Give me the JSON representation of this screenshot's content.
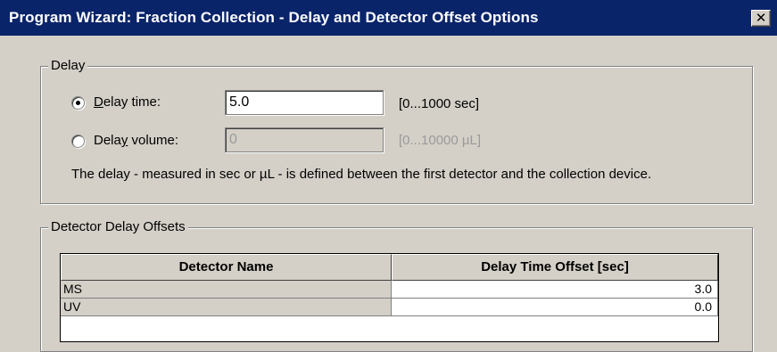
{
  "window": {
    "title": "Program Wizard: Fraction Collection - Delay and Detector Offset Options",
    "close_glyph": "✕"
  },
  "delay": {
    "group_label": "Delay",
    "time": {
      "label_accel": "D",
      "label_rest": "elay time:",
      "value": "5.0",
      "range": "[0...1000 sec]",
      "selected": true
    },
    "volume": {
      "label_pre": "Dela",
      "label_accel": "y",
      "label_rest": " volume:",
      "value": "0",
      "range": "[0...10000 µL]",
      "selected": false
    },
    "description": "The delay - measured in sec or µL - is defined between the first detector and the collection device."
  },
  "offsets": {
    "group_label": "Detector Delay Offsets",
    "columns": [
      "Detector Name",
      "Delay Time Offset [sec]"
    ],
    "rows": [
      {
        "name": "MS",
        "offset": "3.0"
      },
      {
        "name": "UV",
        "offset": "0.0"
      }
    ]
  }
}
